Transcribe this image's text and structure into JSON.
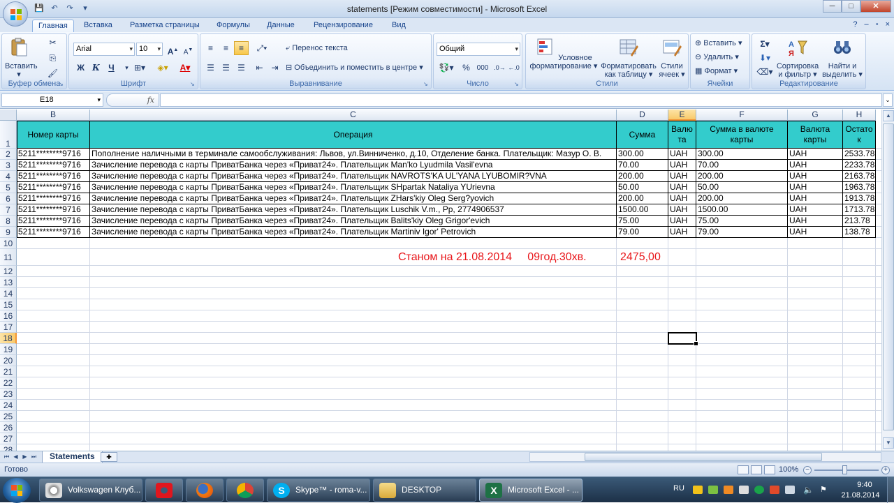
{
  "window": {
    "title": "statements  [Режим совместимости] - Microsoft Excel",
    "controls": [
      "─",
      "□",
      "✕"
    ]
  },
  "qat": {
    "icons": [
      "save-icon",
      "undo-icon",
      "redo-icon",
      "customize-icon"
    ]
  },
  "ribbon": {
    "tabs": [
      "Главная",
      "Вставка",
      "Разметка страницы",
      "Формулы",
      "Данные",
      "Рецензирование",
      "Вид"
    ],
    "active_tab": "Главная",
    "clipboard": {
      "paste": "Вставить",
      "label": "Буфер обмена"
    },
    "font": {
      "name": "Arial",
      "size": "10",
      "bold": "Ж",
      "italic": "К",
      "underline": "Ч",
      "label": "Шрифт"
    },
    "alignment": {
      "wrap": "Перенос текста",
      "merge": "Объединить и поместить в центре",
      "label": "Выравнивание"
    },
    "number": {
      "format": "Общий",
      "percent": "%",
      "thousands": "000",
      "label": "Число"
    },
    "styles": {
      "conditional_1": "Условное",
      "conditional_2": "форматирование",
      "table_1": "Форматировать",
      "table_2": "как таблицу",
      "cell_1": "Стили",
      "cell_2": "ячеек",
      "label": "Стили"
    },
    "cells": {
      "insert": "Вставить",
      "delete": "Удалить",
      "format": "Формат",
      "label": "Ячейки"
    },
    "editing": {
      "sort_1": "Сортировка",
      "sort_2": "и фильтр",
      "find_1": "Найти и",
      "find_2": "выделить",
      "label": "Редактирование"
    }
  },
  "formula_bar": {
    "name_box": "E18",
    "fx": "fx",
    "formula": ""
  },
  "columns": [
    "B",
    "C",
    "D",
    "E",
    "F",
    "G",
    "H"
  ],
  "selected_column": "E",
  "rows": [
    "1",
    "2",
    "3",
    "4",
    "5",
    "6",
    "7",
    "8",
    "9",
    "10",
    "11",
    "12",
    "13",
    "14",
    "15",
    "16",
    "17",
    "18",
    "19",
    "20",
    "21",
    "22",
    "23",
    "24",
    "25",
    "26",
    "27",
    "28"
  ],
  "selected_row": "18",
  "table": {
    "header_color": "#33cccc",
    "headers": {
      "b": "Номер карты",
      "c": "Операция",
      "d": "Сумма",
      "e1": "Валю",
      "e2": "та",
      "f1": "Сумма в валюте",
      "f2": "карты",
      "g1": "Валюта",
      "g2": "карты",
      "h1": "Остато",
      "h2": "к"
    },
    "rows": [
      {
        "card": "5211********9716",
        "op": "Пополнение наличными в терминале самообслуживания: Львов, ул.Винниченко, д.10, Отделение банка. Плательщик: Мазур О. В.",
        "sum": "300.00",
        "cur": "UAH",
        "csum": "300.00",
        "ccur": "UAH",
        "bal": "2533.78"
      },
      {
        "card": "5211********9716",
        "op": "Зачисление перевода с карты ПриватБанка через «Приват24». Плательщик Man'ko Lyudmila Vasil'evna",
        "sum": "70.00",
        "cur": "UAH",
        "csum": "70.00",
        "ccur": "UAH",
        "bal": "2233.78"
      },
      {
        "card": "5211********9716",
        "op": "Зачисление перевода с карты ПриватБанка через «Приват24». Плательщик NAVROTS'KA UL'YANA LYUBOMIR?VNA",
        "sum": "200.00",
        "cur": "UAH",
        "csum": "200.00",
        "ccur": "UAH",
        "bal": "2163.78"
      },
      {
        "card": "5211********9716",
        "op": "Зачисление перевода с карты ПриватБанка через «Приват24». Плательщик SHpartak Nataliya YUrievna",
        "sum": "50.00",
        "cur": "UAH",
        "csum": "50.00",
        "ccur": "UAH",
        "bal": "1963.78"
      },
      {
        "card": "5211********9716",
        "op": "Зачисление перевода с карты ПриватБанка через «Приват24». Плательщик ZHars'kiy Oleg Serg?yovich",
        "sum": "200.00",
        "cur": "UAH",
        "csum": "200.00",
        "ccur": "UAH",
        "bal": "1913.78"
      },
      {
        "card": "5211********9716",
        "op": "Зачисление перевода с карты ПриватБанка через «Приват24». Плательщик Luschik V.m., Рр, 2774906537",
        "sum": "1500.00",
        "cur": "UAH",
        "csum": "1500.00",
        "ccur": "UAH",
        "bal": "1713.78"
      },
      {
        "card": "5211********9716",
        "op": "Зачисление перевода с карты ПриватБанка через «Приват24». Плательщик Balits'kiy Oleg Grigor'evich",
        "sum": "75.00",
        "cur": "UAH",
        "csum": "75.00",
        "ccur": "UAH",
        "bal": "213.78"
      },
      {
        "card": "5211********9716",
        "op": "Зачисление перевода с карты ПриватБанка через «Приват24». Плательщик Martiniv Igor' Petrovich",
        "sum": "79.00",
        "cur": "UAH",
        "csum": "79.00",
        "ccur": "UAH",
        "bal": "138.78"
      }
    ]
  },
  "note": {
    "text": "Станом на 21.08.2014     09год.30хв.",
    "amount": "2475,00",
    "color": "#e8161a"
  },
  "sheet": {
    "tab": "Statements"
  },
  "status": {
    "ready": "Готово",
    "zoom": "100%"
  },
  "taskbar": {
    "items": [
      {
        "label": "Volkswagen Клуб...",
        "icon": "opera-icon"
      },
      {
        "label": "",
        "icon": "opera-red-icon"
      },
      {
        "label": "",
        "icon": "firefox-icon"
      },
      {
        "label": "",
        "icon": "chrome-icon"
      },
      {
        "label": "Skype™ - roma-v...",
        "icon": "skype-icon"
      },
      {
        "label": "DESKTOP",
        "icon": "folder-icon"
      },
      {
        "label": "Microsoft Excel - ...",
        "icon": "excel-icon"
      }
    ],
    "lang": "RU",
    "time": "9:40",
    "date": "21.08.2014"
  }
}
